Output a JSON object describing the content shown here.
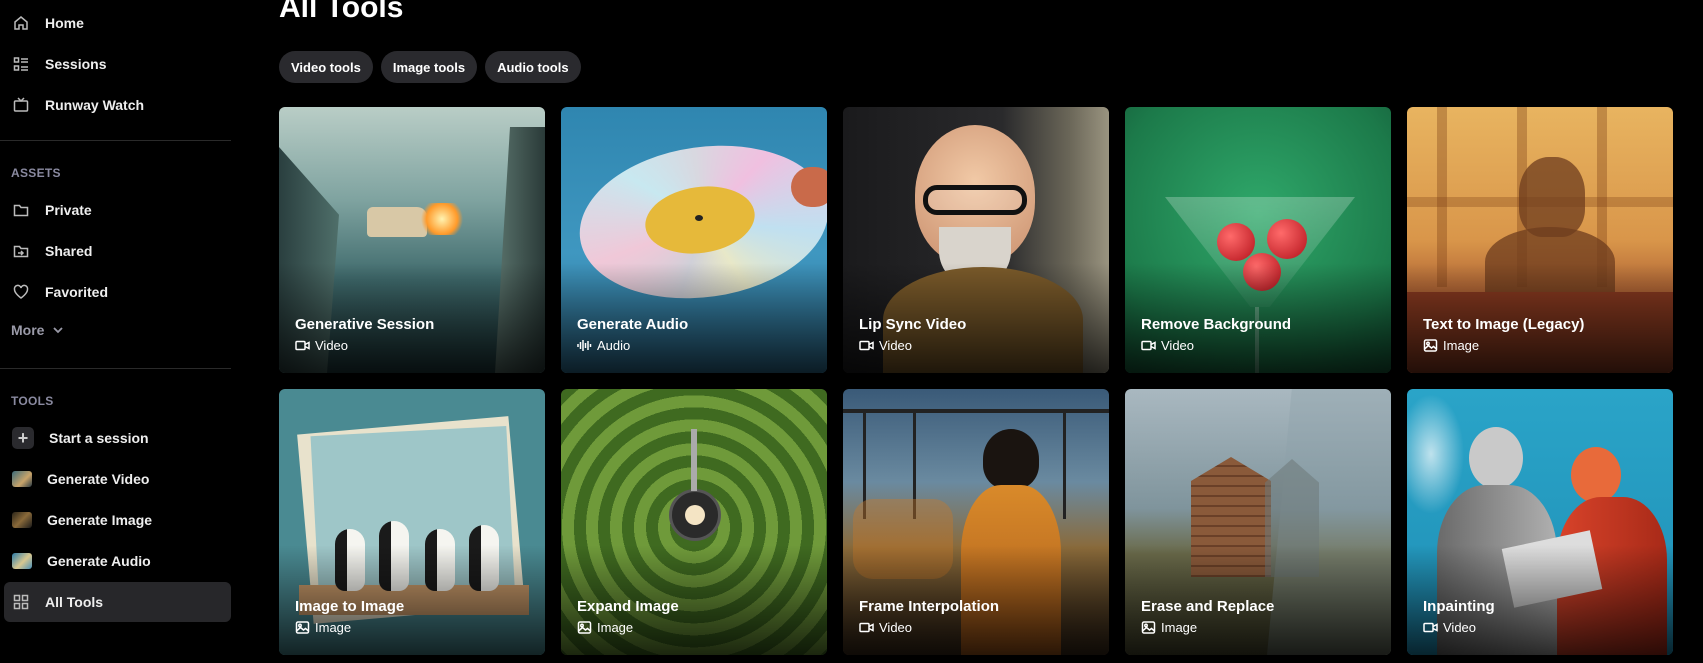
{
  "sidebar": {
    "top": [
      {
        "label": "Home",
        "icon": "home-icon"
      },
      {
        "label": "Sessions",
        "icon": "sessions-icon"
      },
      {
        "label": "Runway Watch",
        "icon": "tv-icon"
      }
    ],
    "assets_label": "ASSETS",
    "assets": [
      {
        "label": "Private",
        "icon": "folder-icon"
      },
      {
        "label": "Shared",
        "icon": "shared-folder-icon"
      },
      {
        "label": "Favorited",
        "icon": "heart-icon"
      }
    ],
    "more_label": "More",
    "tools_label": "TOOLS",
    "tools": [
      {
        "label": "Start a session"
      },
      {
        "label": "Generate Video"
      },
      {
        "label": "Generate Image"
      },
      {
        "label": "Generate Audio"
      },
      {
        "label": "All Tools"
      }
    ]
  },
  "main": {
    "title": "All Tools",
    "filters": [
      "Video tools",
      "Image tools",
      "Audio tools"
    ],
    "cards": [
      {
        "title": "Generative Session",
        "type": "Video"
      },
      {
        "title": "Generate Audio",
        "type": "Audio"
      },
      {
        "title": "Lip Sync Video",
        "type": "Video"
      },
      {
        "title": "Remove Background",
        "type": "Video"
      },
      {
        "title": "Text to Image (Legacy)",
        "type": "Image"
      },
      {
        "title": "Image to Image",
        "type": "Image"
      },
      {
        "title": "Expand Image",
        "type": "Image"
      },
      {
        "title": "Frame Interpolation",
        "type": "Video"
      },
      {
        "title": "Erase and Replace",
        "type": "Image"
      },
      {
        "title": "Inpainting",
        "type": "Video"
      }
    ]
  },
  "colors": {
    "background": "#000000",
    "chip": "#2a2a2e",
    "active_item": "#27272a",
    "section_label": "#8a8aa0"
  }
}
